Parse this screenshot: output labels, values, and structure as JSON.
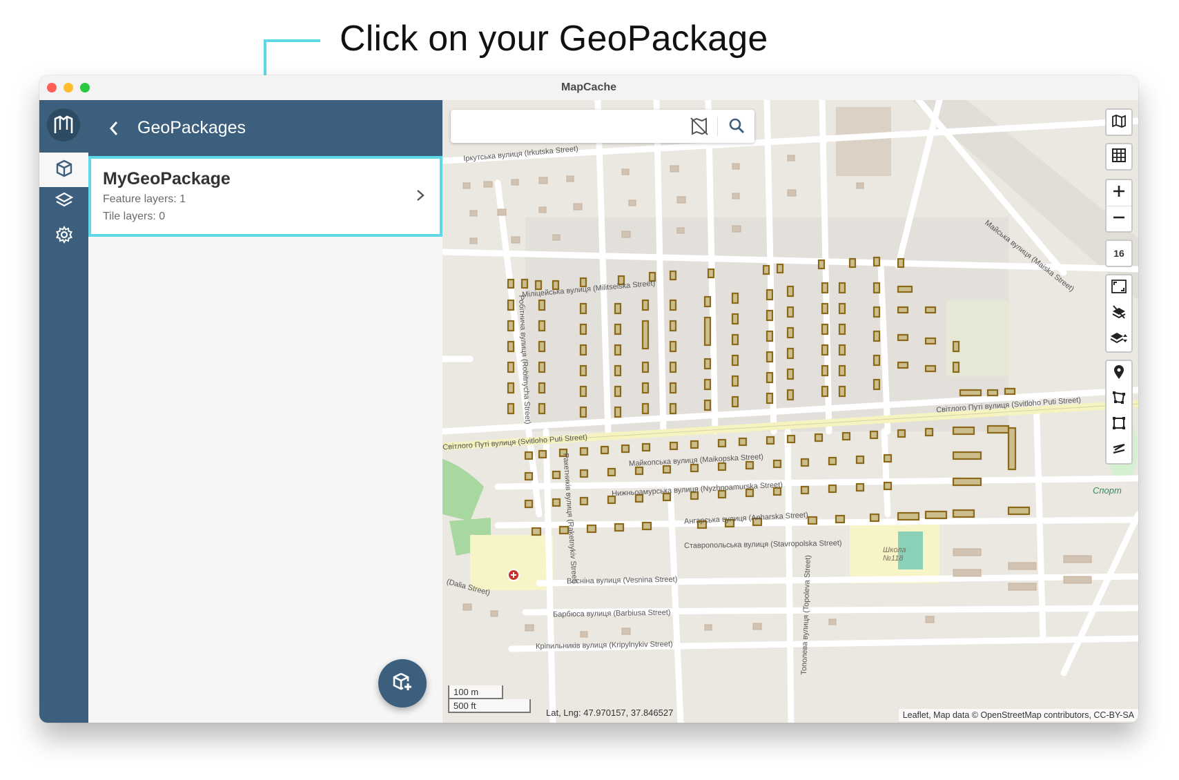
{
  "annotation": {
    "text": "Click on your GeoPackage"
  },
  "window": {
    "title": "MapCache"
  },
  "rail": {
    "items": [
      {
        "name": "geopackages",
        "icon": "geopackage-icon",
        "active": true
      },
      {
        "name": "layers",
        "icon": "layers-icon",
        "active": false
      },
      {
        "name": "settings",
        "icon": "gear-icon",
        "active": false
      }
    ]
  },
  "panel": {
    "title": "GeoPackages",
    "geopackages": [
      {
        "name": "MyGeoPackage",
        "feature_layers": "Feature layers: 1",
        "tile_layers": "Tile layers: 0"
      }
    ],
    "fab_icon": "add-geopackage-icon"
  },
  "map": {
    "search": {
      "placeholder": "",
      "value": ""
    },
    "zoom_level": "16",
    "scale": {
      "metric": "100 m",
      "imperial": "500 ft"
    },
    "latlng": "Lat, Lng: 47.970157, 37.846527",
    "attribution": "Leaflet, Map data © OpenStreetMap contributors, CC-BY-SA",
    "streets": [
      "Іркутська вулиця (Irkutska Street)",
      "Міліцейська вулиця (Militseiska Street)",
      "Світлого Путі вулиця (Svitloho Puti Street)",
      "Майкопська вулиця (Maikopska Street)",
      "Нижньоамурська вулиця (Nyzhnoamurska Street)",
      "Ангарська вулиця (Anharska Street)",
      "Ставропольська вулиця (Stavropolska Street)",
      "Весніна вулиця (Vesnina Street)",
      "Барбюса вулиця (Barbiusa Street)",
      "Кріпильників вулиця (Kripylnykiv Street)",
      "Робітнича вулиця (Robitnycha Street)",
      "Ракетників вулиця (Raketnykiv Street)",
      "Тополева вулиця (Topoleva Street)",
      "Майська вулиця (Maiska Street)",
      "(Dalia Street)"
    ],
    "poi": {
      "school": "Школа №118",
      "sport": "Спорт"
    },
    "controls": [
      "basemap-icon",
      "grid-icon",
      "zoom-in-icon",
      "zoom-out-icon",
      "fullscreen-icon",
      "clear-layers-icon",
      "layer-order-icon",
      "draw-marker-icon",
      "draw-polygon-icon",
      "draw-rectangle-icon",
      "draw-line-icon"
    ]
  }
}
